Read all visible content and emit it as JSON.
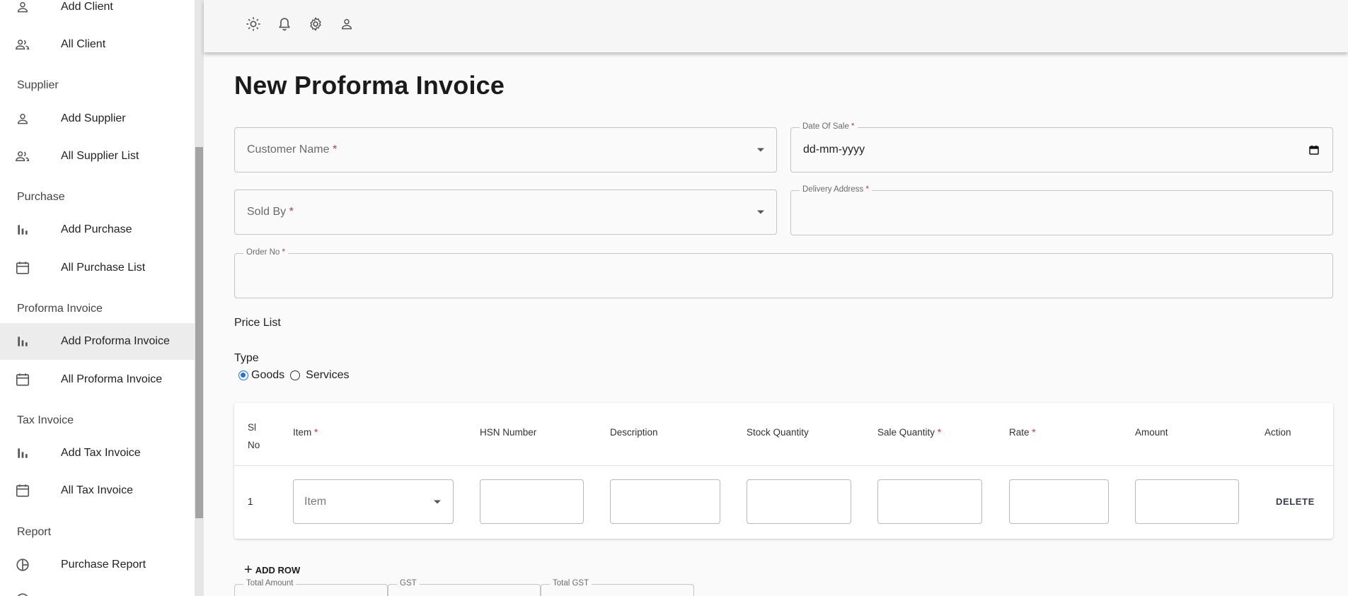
{
  "sidebar": {
    "items": [
      {
        "label": "Add Client",
        "icon": "person-icon"
      },
      {
        "label": "All Client",
        "icon": "people-icon"
      },
      {
        "label": "Add Supplier",
        "icon": "person-icon"
      },
      {
        "label": "All Supplier List",
        "icon": "people-icon"
      },
      {
        "label": "Add Purchase",
        "icon": "bar-chart-icon"
      },
      {
        "label": "All Purchase List",
        "icon": "calendar-icon"
      },
      {
        "label": "Add Proforma Invoice",
        "icon": "bar-chart-icon",
        "active": true
      },
      {
        "label": "All Proforma Invoice",
        "icon": "calendar-icon"
      },
      {
        "label": "Add Tax Invoice",
        "icon": "bar-chart-icon"
      },
      {
        "label": "All Tax Invoice",
        "icon": "calendar-icon"
      },
      {
        "label": "Purchase Report",
        "icon": "pie-chart-icon"
      }
    ],
    "sections": [
      "Supplier",
      "Purchase",
      "Proforma Invoice",
      "Tax Invoice",
      "Report"
    ]
  },
  "topbar": {
    "icons": [
      "sun-icon",
      "bell-icon",
      "settings-icon",
      "account-icon"
    ]
  },
  "page": {
    "title": "New Proforma Invoice"
  },
  "form": {
    "customer_name": {
      "placeholder": "Customer Name",
      "required": "*"
    },
    "date_of_sale": {
      "label": "Date Of Sale",
      "required": "*",
      "value": "dd-mm-yyyy"
    },
    "sold_by": {
      "placeholder": "Sold By",
      "required": "*"
    },
    "delivery_address": {
      "label": "Delivery Address",
      "required": "*"
    },
    "order_no": {
      "label": "Order No",
      "required": "*"
    },
    "price_list_label": "Price List",
    "type_label": "Type",
    "type_options": [
      "Goods",
      "Services"
    ],
    "type_selected": "Goods"
  },
  "table": {
    "headers": {
      "sl_line1": "Sl",
      "sl_line2": "No",
      "item": "Item",
      "hsn": "HSN Number",
      "description": "Description",
      "stock_qty": "Stock Quantity",
      "sale_qty": "Sale Quantity",
      "rate": "Rate",
      "amount": "Amount",
      "action": "Action"
    },
    "required_mark": "*",
    "rows": [
      {
        "sl": "1",
        "item_placeholder": "Item",
        "delete_label": "DELETE"
      }
    ]
  },
  "actions": {
    "add_row_label": "ADD ROW"
  },
  "totals": {
    "total_amount_label": "Total Amount",
    "gst_label": "GST",
    "total_gst_label": "Total GST"
  }
}
